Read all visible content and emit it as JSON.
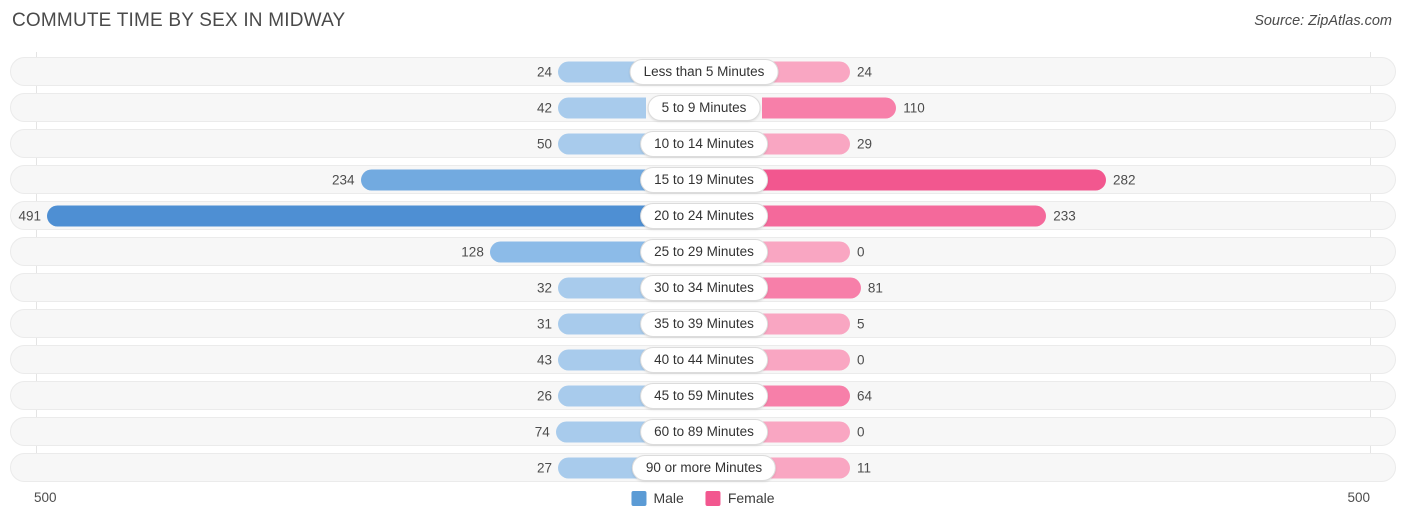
{
  "header": {
    "title": "COMMUTE TIME BY SEX IN MIDWAY",
    "source": "Source: ZipAtlas.com"
  },
  "axis": {
    "left_max": "500",
    "right_max": "500"
  },
  "legend": {
    "items": [
      {
        "label": "Male",
        "color": "#5b9bd5"
      },
      {
        "label": "Female",
        "color": "#f2578f"
      }
    ]
  },
  "chart_data": {
    "type": "bar",
    "subtype": "diverging-horizontal-bar",
    "title": "COMMUTE TIME BY SEX IN MIDWAY",
    "xlabel": "",
    "ylabel": "",
    "xlim": [
      500,
      500
    ],
    "axis_max": 500,
    "grid": true,
    "legend_position": "bottom-center",
    "categories": [
      "Less than 5 Minutes",
      "5 to 9 Minutes",
      "10 to 14 Minutes",
      "15 to 19 Minutes",
      "20 to 24 Minutes",
      "25 to 29 Minutes",
      "30 to 34 Minutes",
      "35 to 39 Minutes",
      "40 to 44 Minutes",
      "45 to 59 Minutes",
      "60 to 89 Minutes",
      "90 or more Minutes"
    ],
    "series": [
      {
        "name": "Male",
        "direction": "left",
        "color": "#5b9bd5",
        "values": [
          24,
          42,
          50,
          234,
          491,
          128,
          32,
          31,
          43,
          26,
          74,
          27
        ]
      },
      {
        "name": "Female",
        "direction": "right",
        "color": "#f2578f",
        "values": [
          24,
          110,
          29,
          282,
          233,
          0,
          81,
          5,
          0,
          64,
          0,
          11
        ]
      }
    ]
  },
  "rows": [
    {
      "label": "Less than 5 Minutes",
      "male": "24",
      "female": "24"
    },
    {
      "label": "5 to 9 Minutes",
      "male": "42",
      "female": "110"
    },
    {
      "label": "10 to 14 Minutes",
      "male": "50",
      "female": "29"
    },
    {
      "label": "15 to 19 Minutes",
      "male": "234",
      "female": "282"
    },
    {
      "label": "20 to 24 Minutes",
      "male": "491",
      "female": "233"
    },
    {
      "label": "25 to 29 Minutes",
      "male": "128",
      "female": "0"
    },
    {
      "label": "30 to 34 Minutes",
      "male": "32",
      "female": "81"
    },
    {
      "label": "35 to 39 Minutes",
      "male": "31",
      "female": "5"
    },
    {
      "label": "40 to 44 Minutes",
      "male": "43",
      "female": "0"
    },
    {
      "label": "45 to 59 Minutes",
      "male": "26",
      "female": "64"
    },
    {
      "label": "60 to 89 Minutes",
      "male": "74",
      "female": "0"
    },
    {
      "label": "90 or more Minutes",
      "male": "27",
      "female": "11"
    }
  ]
}
